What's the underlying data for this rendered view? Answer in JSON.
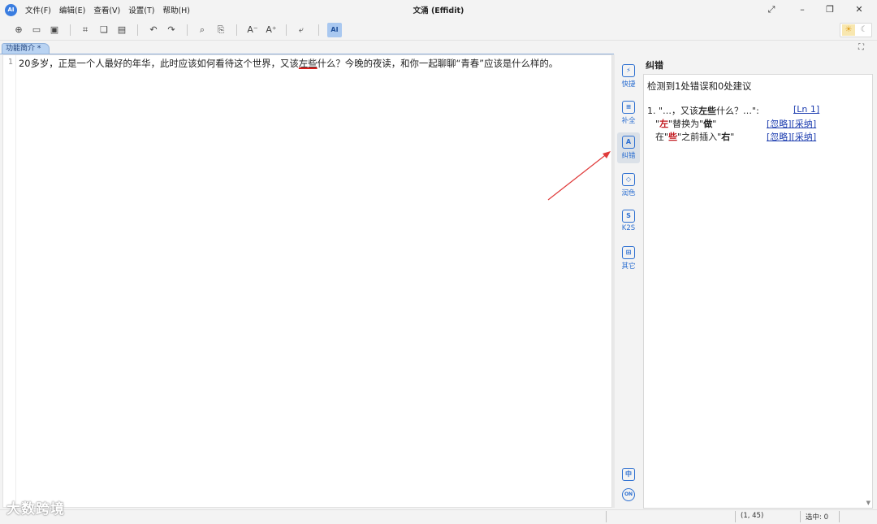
{
  "window": {
    "logo": "AI",
    "title": "文涌 (Effidit)",
    "menu": [
      "文件(F)",
      "编辑(E)",
      "查看(V)",
      "设置(T)",
      "帮助(H)"
    ],
    "controls": [
      "expand-icon",
      "minimize-icon",
      "restore-icon",
      "close-icon"
    ]
  },
  "toolbar": {
    "icons": [
      "new-file-icon",
      "open-folder-icon",
      "save-icon",
      "crop-icon",
      "copy-icon",
      "paste-icon",
      "undo-icon",
      "redo-icon",
      "find-icon",
      "replace-icon",
      "decrease-font-icon",
      "increase-font-icon",
      "wrap-icon",
      "ai-check-icon"
    ],
    "ai_label": "AI"
  },
  "theme": {
    "light": "sun-icon",
    "dark": "moon-icon"
  },
  "tab": {
    "label": "功能简介 *"
  },
  "editor": {
    "line_number": "1",
    "text_before": "20多岁，正是一个人最好的年华，此时应该如何看待这个世界，又该",
    "text_error": "左些",
    "text_after": "什么？今晚的夜读，和你一起聊聊“青春”应该是什么样的。"
  },
  "sidebar": {
    "items": [
      {
        "label": "快捷",
        "icon": "lightning-icon",
        "glyph": "⚡"
      },
      {
        "label": "补全",
        "icon": "document-icon",
        "glyph": "≡"
      },
      {
        "label": "纠错",
        "icon": "ab-check-icon",
        "glyph": "A"
      },
      {
        "label": "润色",
        "icon": "polish-icon",
        "glyph": "◇"
      },
      {
        "label": "K2S",
        "icon": "k2s-icon",
        "glyph": "S"
      },
      {
        "label": "其它",
        "icon": "grid-icon",
        "glyph": "⊞"
      }
    ],
    "bottom": [
      {
        "icon": "chinese-icon",
        "glyph": "中"
      },
      {
        "icon": "cloud-on-icon",
        "glyph": "ON"
      }
    ]
  },
  "panel": {
    "title": "纠错",
    "summary": "检测到1处错误和0处建议",
    "error": {
      "index": "1.",
      "context_before": "\"…，又该",
      "context_error": "左些",
      "context_after": "什么？…\":",
      "location": "[Ln 1]",
      "suggestions": [
        {
          "q1": "\"",
          "word": "左",
          "mid": "\"替换为\"",
          "target": "做",
          "q2": "\"",
          "ignore": "[忽略]",
          "accept": "[采纳]"
        },
        {
          "prefix": "在\"",
          "word": "些",
          "mid": "\"之前插入\"",
          "target": "右",
          "q2": "\"",
          "ignore": "[忽略]",
          "accept": "[采纳]"
        }
      ]
    }
  },
  "status": {
    "position": "(1, 45)",
    "selection": "选中: 0"
  },
  "watermark": "大数跨境",
  "colors": {
    "accent": "#2c6fd1",
    "error": "#d8201c",
    "tab": "#b9d3f2"
  }
}
